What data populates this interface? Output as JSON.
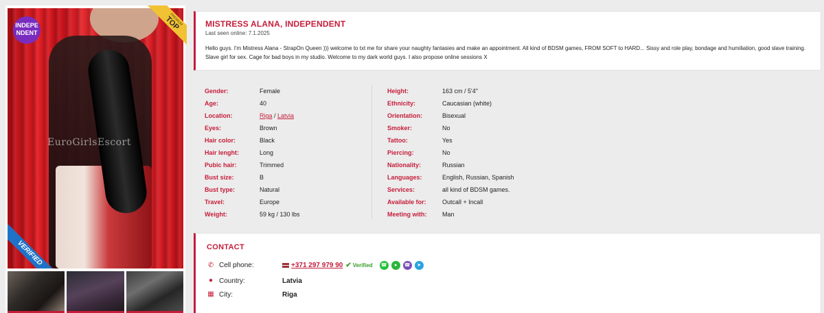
{
  "photo": {
    "independent_badge": "INDEPE NDENT",
    "premium_label": "PREMIUM",
    "top_label": "TOP",
    "verified_label": "VERIFIED",
    "watermark": "EuroGirlsEscort"
  },
  "profile": {
    "title": "MISTRESS ALANA, INDEPENDENT",
    "last_seen": "Last seen online: 7.1.2025",
    "description": "Hello guys. I'm Mistress Alana - StrapOn Queen ))) welcome to txt me for share your naughty fantasies and make an appointment. All kind of BDSM games, FROM SOFT to HARD... Sissy and role play, bondage and humiliation, good slave training. Slave girl for sex. Cage for bad boys in my studio. Welcome to my dark world guys. I also propose online sessions X"
  },
  "details_left": [
    {
      "key": "Gender:",
      "value": "Female"
    },
    {
      "key": "Age:",
      "value": "40"
    },
    {
      "key": "Location:",
      "value_city": "Riga",
      "value_sep": " / ",
      "value_country": "Latvia"
    },
    {
      "key": "Eyes:",
      "value": "Brown"
    },
    {
      "key": "Hair color:",
      "value": "Black"
    },
    {
      "key": "Hair lenght:",
      "value": "Long"
    },
    {
      "key": "Pubic hair:",
      "value": "Trimmed"
    },
    {
      "key": "Bust size:",
      "value": "B"
    },
    {
      "key": "Bust type:",
      "value": "Natural"
    },
    {
      "key": "Travel:",
      "value": "Europe"
    },
    {
      "key": "Weight:",
      "value": "59 kg / 130 lbs"
    }
  ],
  "details_right": [
    {
      "key": "Height:",
      "value": "163 cm / 5'4\""
    },
    {
      "key": "Ethnicity:",
      "value": "Caucasian (white)"
    },
    {
      "key": "Orientation:",
      "value": "Bisexual"
    },
    {
      "key": "Smoker:",
      "value": "No"
    },
    {
      "key": "Tattoo:",
      "value": "Yes"
    },
    {
      "key": "Piercing:",
      "value": "No"
    },
    {
      "key": "Nationality:",
      "value": "Russian"
    },
    {
      "key": "Languages:",
      "value": "English, Russian, Spanish"
    },
    {
      "key": "Services:",
      "value": "all kind of BDSM games."
    },
    {
      "key": "Available for:",
      "value": "Outcall + Incall"
    },
    {
      "key": "Meeting with:",
      "value": "Man"
    }
  ],
  "contact": {
    "title": "CONTACT",
    "phone_label": "Cell phone:",
    "phone": "+371 297 979 90",
    "verified": "Verified",
    "country_label": "Country:",
    "country": "Latvia",
    "city_label": "City:",
    "city": "Riga",
    "messengers": [
      "whatsapp-icon",
      "wechat-icon",
      "viber-icon",
      "telegram-icon"
    ]
  },
  "colors": {
    "accent": "#c51d3a",
    "verified_green": "#3a9d2b",
    "badge_purple": "#7a2cbf",
    "ribbon_blue": "#1e73c8",
    "ribbon_gold": "#f1c233"
  }
}
